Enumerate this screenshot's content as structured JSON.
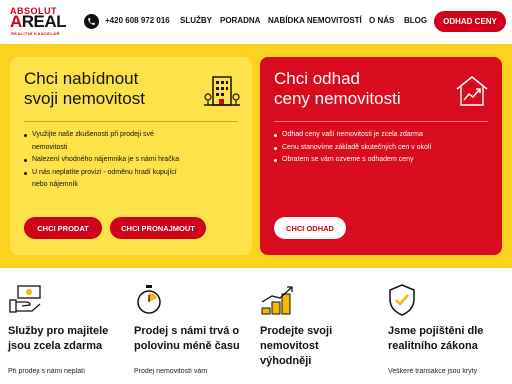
{
  "header": {
    "logo": {
      "line1": "ABSOLUT",
      "line2_a": "A",
      "line2_rest": "REAL",
      "line3": "REALITNÍ KANCELÁŘ"
    },
    "phone": "+420 608 972 016",
    "nav": [
      "SLUŽBY",
      "PORADNA",
      "NABÍDKA NEMOVITOSTÍ",
      "O NÁS",
      "BLOG"
    ],
    "cta": "ODHAD CENY"
  },
  "colors": {
    "brand_red": "#d0021b",
    "brand_yellow": "#fdd21e"
  },
  "cards": {
    "left": {
      "title_line1": "Chci nabídnout",
      "title_line2": "svoji nemovitost",
      "icon": "building-icon",
      "bullets": [
        "Využijte naše zkušenosti při prodeji své",
        "nemovitosti",
        "Nalezení vhodného nájemnika je s námi hračka",
        "U nás neplatíte provizi - odměnu hradí kupující",
        "nebo nájemník"
      ],
      "btn_sell": "CHCI PRODAT",
      "btn_rent": "CHCI PRONAJMOUT"
    },
    "right": {
      "title_line1": "Chci odhad",
      "title_line2": "ceny nemovitosti",
      "icon": "house-chart-icon",
      "bullets": [
        "Odhad ceny vaší nemovitosti je zcela zdarma",
        "Cenu stanovíme základě skutečných cen v okolí",
        "Obratem se vám ozveme s odhadem ceny"
      ],
      "btn": "CHCI ODHAD"
    }
  },
  "features": [
    {
      "icon": "money-hand-icon",
      "title_line1": "Služby pro majitele",
      "title_line2": "jsou zcela zdarma",
      "text": "Při prodeji s námi neplatí"
    },
    {
      "icon": "stopwatch-icon",
      "title_line1": "Prodej s námi trvá o",
      "title_line2": "polovinu méně času",
      "text": "Prodej nemovitostí vám"
    },
    {
      "icon": "coin-stack-growth-icon",
      "title_line1": "Prodejte svoji",
      "title_line2": "nemovitost",
      "title_line3": "výhodněji",
      "text": ""
    },
    {
      "icon": "shield-check-icon",
      "title_line1": "Jsme pojištěni dle",
      "title_line2": "realitního zákona",
      "text": "Veškeré transakce jsou kryty"
    }
  ]
}
